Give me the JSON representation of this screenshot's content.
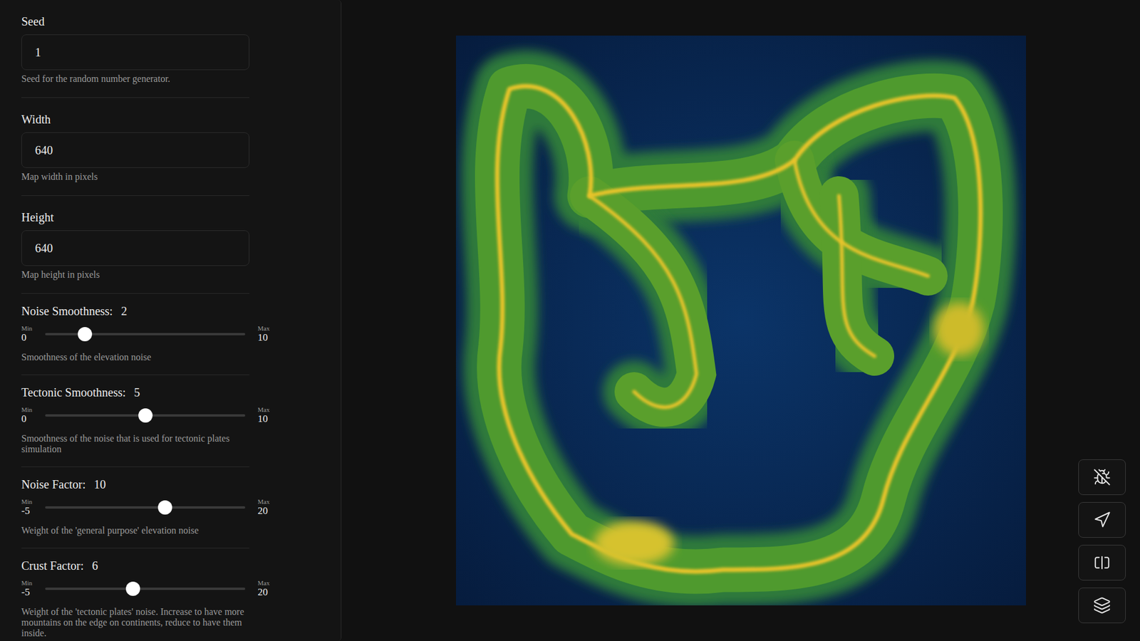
{
  "sidebar": {
    "fields": [
      {
        "kind": "input",
        "label": "Seed",
        "value": "1",
        "description": "Seed for the random number generator."
      },
      {
        "kind": "input",
        "label": "Width",
        "value": "640",
        "description": "Map width in pixels"
      },
      {
        "kind": "input",
        "label": "Height",
        "value": "640",
        "description": "Map height in pixels"
      },
      {
        "kind": "slider",
        "label": "Noise Smoothness:",
        "value": "2",
        "min_label": "Min",
        "min": "0",
        "max_label": "Max",
        "max": "10",
        "level": 0.2,
        "description": "Smoothness of the elevation noise"
      },
      {
        "kind": "slider",
        "label": "Tectonic Smoothness:",
        "value": "5",
        "min_label": "Min",
        "min": "0",
        "max_label": "Max",
        "max": "10",
        "level": 0.5,
        "description": "Smoothness of the noise that is used for tectonic plates simulation"
      },
      {
        "kind": "slider",
        "label": "Noise Factor:",
        "value": "10",
        "min_label": "Min",
        "min": "-5",
        "max_label": "Max",
        "max": "20",
        "level": 0.6,
        "description": "Weight of the 'general purpose' elevation noise"
      },
      {
        "kind": "slider",
        "label": "Crust Factor:",
        "value": "6",
        "min_label": "Min",
        "min": "-5",
        "max_label": "Max",
        "max": "20",
        "level": 0.44,
        "description": "Weight of the 'tectonic plates' noise. Increase to have more mountains on the edge on continents, reduce to have them inside."
      }
    ]
  }
}
